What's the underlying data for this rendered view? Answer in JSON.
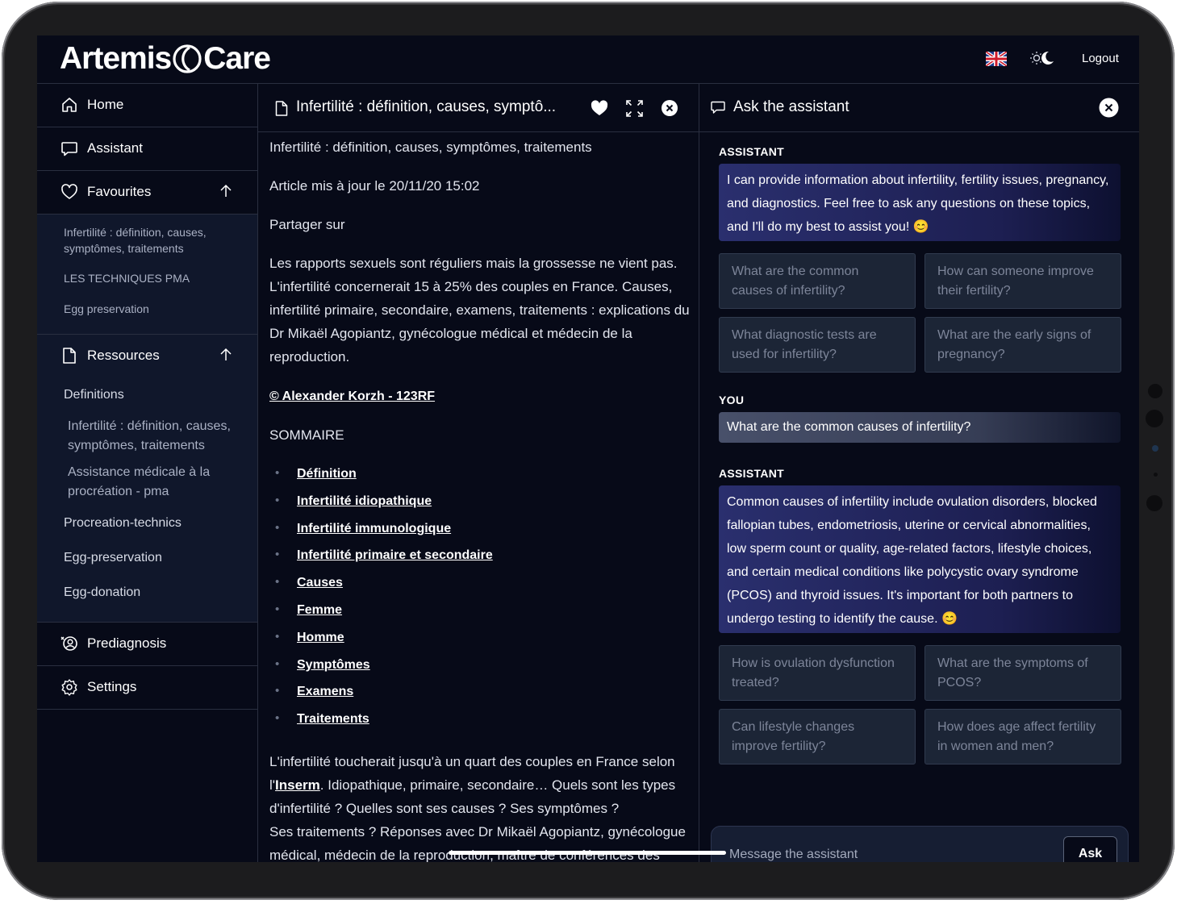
{
  "header": {
    "logo_left": "Artemis",
    "logo_right": "Care",
    "logout": "Logout"
  },
  "sidebar": {
    "home": "Home",
    "assistant": "Assistant",
    "favourites": "Favourites",
    "favourites_items": [
      "Infertilité : définition, causes, symptômes, traitements",
      "LES TECHNIQUES PMA",
      "Egg preservation"
    ],
    "ressources": "Ressources",
    "ressources_items": {
      "definitions": "Definitions",
      "def_sub_1": "Infertilité : définition, causes, symptômes, traitements",
      "def_sub_2": "Assistance médicale à la procréation - pma",
      "procreation": "Procreation-technics",
      "egg_preservation": "Egg-preservation",
      "egg_donation": "Egg-donation"
    },
    "prediagnosis": "Prediagnosis",
    "settings": "Settings"
  },
  "article": {
    "tab_title": "Infertilité : définition, causes, symptô...",
    "heading": "Infertilité : définition, causes, symptômes, traitements",
    "updated": "Article mis à jour le 20/11/20 15:02",
    "share": "Partager sur",
    "intro": "Les rapports sexuels sont réguliers mais la grossesse ne vient pas. L'infertilité concernerait 15 à 25% des couples en France. Causes, infertilité primaire, secondaire, examens, traitements : explications du Dr Mikaël Agopiantz, gynécologue médical et médecin de la reproduction.",
    "credit": "© Alexander Korzh - 123RF",
    "summary_title": "SOMMAIRE",
    "toc": [
      "Définition",
      "Infertilité idiopathique",
      "Infertilité immunologique",
      "Infertilité primaire et secondaire",
      "Causes",
      "Femme",
      "Homme",
      "Symptômes",
      "Examens",
      "Traitements"
    ],
    "para2_before": "L'infertilité toucherait jusqu'à un quart des couples en France selon l'",
    "para2_link": "Inserm",
    "para2_after": ". Idiopathique, primaire, secondaire… Quels sont les types d'infertilité ? Quelles sont ses causes ? Ses symptômes ?",
    "para3": "Ses traitements ? Réponses avec Dr Mikaël Agopiantz, gynécologue médical, médecin de la reproduction, maître de conférences des"
  },
  "assistant": {
    "title": "Ask the assistant",
    "role_assistant": "ASSISTANT",
    "role_you": "YOU",
    "msg1": "I can provide information about infertility, fertility issues, pregnancy, and diagnostics. Feel free to ask any questions on these topics, and I'll do my best to assist you! 😊",
    "suggestions1": [
      "What are the common causes of infertility?",
      "How can someone improve their fertility?",
      "What diagnostic tests are used for infertility?",
      "What are the early signs of pregnancy?"
    ],
    "user_msg": "What are the common causes of infertility?",
    "msg2": "Common causes of infertility include ovulation disorders, blocked fallopian tubes, endometriosis, uterine or cervical abnormalities, low sperm count or quality, age-related factors, lifestyle choices, and certain medical conditions like polycystic ovary syndrome (PCOS) and thyroid issues. It's important for both partners to undergo testing to identify the cause. 😊",
    "suggestions2": [
      "How is ovulation dysfunction treated?",
      "What are the symptoms of PCOS?",
      "Can lifestyle changes improve fertility?",
      "How does age affect fertility in women and men?"
    ],
    "input_placeholder": "Message the assistant",
    "ask": "Ask"
  }
}
